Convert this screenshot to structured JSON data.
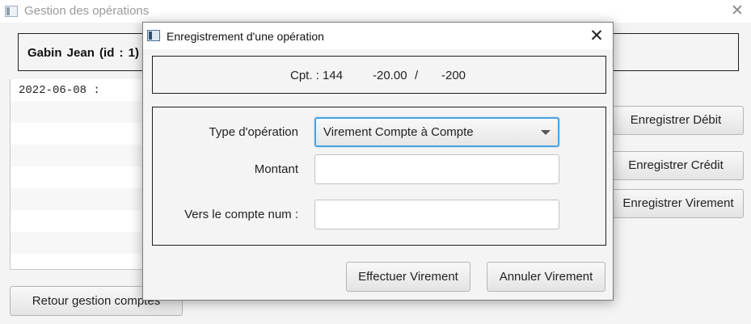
{
  "main_window": {
    "title": "Gestion des opérations",
    "close_glyph": "✕",
    "client_label": "Gabin  Jean  (id : 1)",
    "operations": [
      "2022-06-08 :",
      "",
      "",
      "",
      "",
      "",
      "",
      "",
      ""
    ],
    "buttons": {
      "debit": "Enregistrer Débit",
      "credit": "Enregistrer Crédit",
      "virement": "Enregistrer Virement",
      "retour": "Retour gestion comptes"
    }
  },
  "dialog": {
    "title": "Enregistrement d'une opération",
    "close_glyph": "✕",
    "account": {
      "num": "Cpt. : 144",
      "solde": "-20.00",
      "separator": "/",
      "decouvert": "-200"
    },
    "form": {
      "type_label": "Type d'opération",
      "type_value": "Virement Compte à Compte",
      "montant_label": "Montant",
      "montant_value": "",
      "compte_label": "Vers le compte num :",
      "compte_value": ""
    },
    "buttons": {
      "effectuer": "Effectuer Virement",
      "annuler": "Annuler Virement"
    }
  },
  "colors": {
    "focus_accent": "#4aa3df",
    "box_border": "#1f1f1f",
    "background": "#f4f4f4"
  }
}
